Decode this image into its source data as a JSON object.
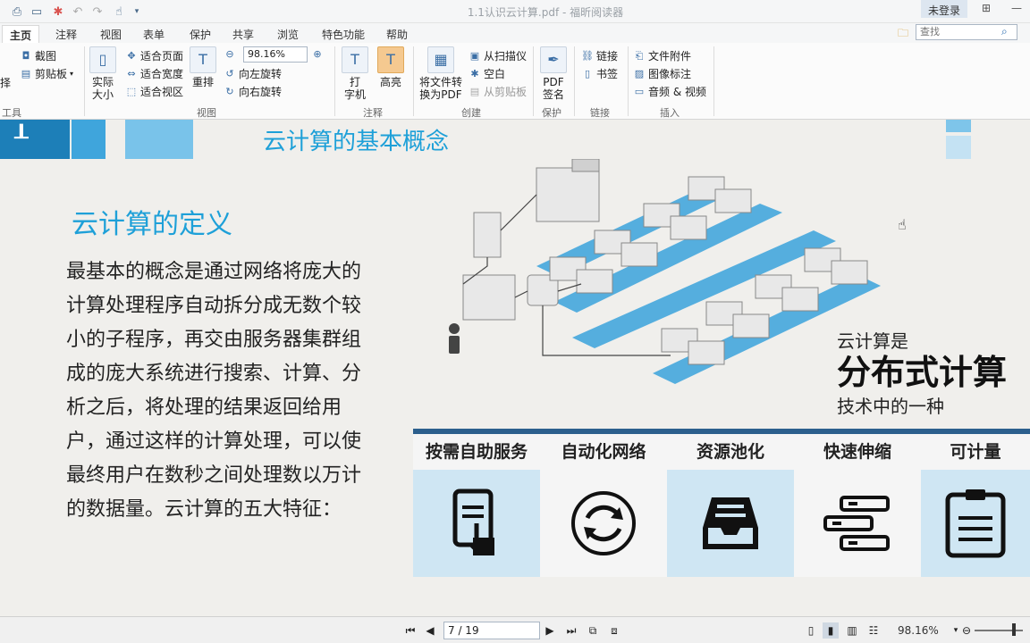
{
  "titlebar": {
    "doc_title": "1.1认识云计算.pdf - 福昕阅读器",
    "login": "未登录"
  },
  "tabs": [
    "主页",
    "注释",
    "视图",
    "表单",
    "保护",
    "共享",
    "浏览",
    "特色功能",
    "帮助"
  ],
  "search": {
    "placeholder": "查找"
  },
  "ribbon": {
    "tools_group": {
      "label": "工具",
      "select": "择",
      "screenshot": "截图",
      "clipboard": "剪贴板"
    },
    "view_group": {
      "label": "视图",
      "actual_size": "实际\n大小",
      "fit_page": "适合页面",
      "fit_width": "适合宽度",
      "fit_view": "适合视区",
      "reflow": "重排",
      "zoom": "98.16%",
      "rotate_left": "向左旋转",
      "rotate_right": "向右旋转"
    },
    "annot_group": {
      "label": "注释",
      "typewriter": "打\n字机",
      "highlight": "高亮"
    },
    "create_group": {
      "label": "创建",
      "convert": "将文件转\n换为PDF",
      "from_scanner": "从扫描仪",
      "blank": "空白",
      "from_clipboard": "从剪贴板"
    },
    "protect_group": {
      "label": "保护",
      "pdf_sign": "PDF\n签名"
    },
    "link_group": {
      "label": "链接",
      "link": "链接",
      "bookmark": "书签"
    },
    "insert_group": {
      "label": "插入",
      "file_attach": "文件附件",
      "image_annot": "图像标注",
      "audio_video": "音频 & 视频"
    }
  },
  "slide": {
    "title": "云计算的基本概念",
    "definition_title": "云计算的定义",
    "body": "最基本的概念是通过网络将庞大的计算处理程序自动拆分成无数个较小的子程序，再交由服务器集群组成的庞大系统进行搜索、计算、分 析之后，将处理的结果返回给用户，通过这样的计算处理，可以使最终用户在数秒之间处理数以万计的数据量。云计算的五大特征：",
    "note_line1": "云计算是",
    "note_line2": "分布式计算",
    "note_line3": "技术中的一种",
    "features": [
      {
        "label": "按需自助服务",
        "icon": "tablet-touch-icon"
      },
      {
        "label": "自动化网络",
        "icon": "refresh-cycle-icon"
      },
      {
        "label": "资源池化",
        "icon": "inbox-tray-icon"
      },
      {
        "label": "快速伸缩",
        "icon": "server-stack-icon"
      },
      {
        "label": "可计量",
        "icon": "clipboard-list-icon"
      }
    ]
  },
  "statusbar": {
    "page": "7 / 19",
    "zoom": "98.16%"
  },
  "colors": {
    "accent_blue": "#1ea0d8",
    "feature_bar": "#2c5f8d",
    "light_blue_panel": "#cfe6f3"
  }
}
